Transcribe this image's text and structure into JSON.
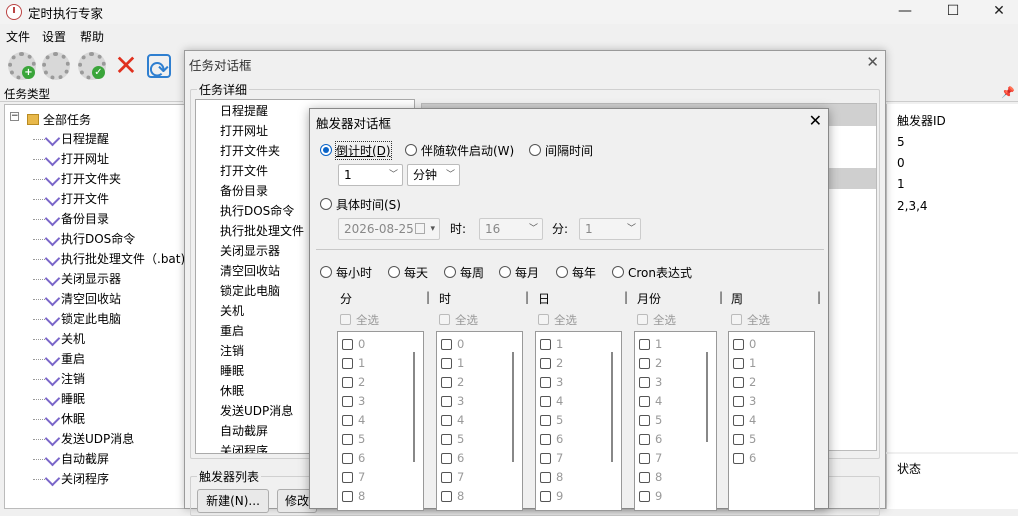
{
  "app": {
    "title": "定时执行专家"
  },
  "menu": [
    "文件",
    "设置",
    "帮助"
  ],
  "left_panel": {
    "header": "任务类型",
    "root": "全部任务",
    "items": [
      "日程提醒",
      "打开网址",
      "打开文件夹",
      "打开文件",
      "备份目录",
      "执行DOS命令",
      "执行批处理文件（.bat)",
      "关闭显示器",
      "清空回收站",
      "锁定此电脑",
      "关机",
      "重启",
      "注销",
      "睡眠",
      "休眠",
      "发送UDP消息",
      "自动截屏",
      "关闭程序"
    ]
  },
  "right_grid": {
    "col_trigger_id": "触发器ID",
    "trigger_ids": [
      "5",
      "0",
      "1",
      "2,3,4"
    ],
    "col_status": "状态"
  },
  "task_dialog": {
    "title": "任务对话框",
    "details_group": "任务详细",
    "task_types": [
      "日程提醒",
      "打开网址",
      "打开文件夹",
      "打开文件",
      "备份目录",
      "执行DOS命令",
      "执行批处理文件",
      "关闭显示器",
      "清空回收站",
      "锁定此电脑",
      "关机",
      "重启",
      "注销",
      "睡眠",
      "休眠",
      "发送UDP消息",
      "自动截屏",
      "关闭程序"
    ],
    "trigger_group": "触发器列表",
    "btn_new": "新建(N)...",
    "btn_edit": "修改"
  },
  "trigger_dialog": {
    "title": "触发器对话框",
    "mode_countdown": "倒计时(D)",
    "mode_with_software": "伴随软件启动(W)",
    "mode_interval": "间隔时间",
    "countdown_value": "1",
    "countdown_unit": "分钟",
    "mode_specific": "具体时间(S)",
    "date_value": "2026-08-25",
    "hour_label": "时:",
    "hour_value": "16",
    "minute_label": "分:",
    "minute_value": "1",
    "freq_hourly": "每小时",
    "freq_daily": "每天",
    "freq_weekly": "每周",
    "freq_monthly": "每月",
    "freq_yearly": "每年",
    "freq_cron": "Cron表达式",
    "columns": [
      {
        "header": "分",
        "select_all": "全选",
        "values": [
          "0",
          "1",
          "2",
          "3",
          "4",
          "5",
          "6",
          "7",
          "8"
        ]
      },
      {
        "header": "时",
        "select_all": "全选",
        "values": [
          "0",
          "1",
          "2",
          "3",
          "4",
          "5",
          "6",
          "7",
          "8"
        ]
      },
      {
        "header": "日",
        "select_all": "全选",
        "values": [
          "1",
          "2",
          "3",
          "4",
          "5",
          "6",
          "7",
          "8",
          "9"
        ]
      },
      {
        "header": "月份",
        "select_all": "全选",
        "values": [
          "1",
          "2",
          "3",
          "4",
          "5",
          "6",
          "7",
          "8",
          "9"
        ]
      },
      {
        "header": "周",
        "select_all": "全选",
        "values": [
          "0",
          "1",
          "2",
          "3",
          "4",
          "5",
          "6"
        ]
      }
    ]
  },
  "colors": {
    "accent": "#0a64c8",
    "delete_red": "#e0301e",
    "refresh_blue": "#2f7fd0"
  }
}
